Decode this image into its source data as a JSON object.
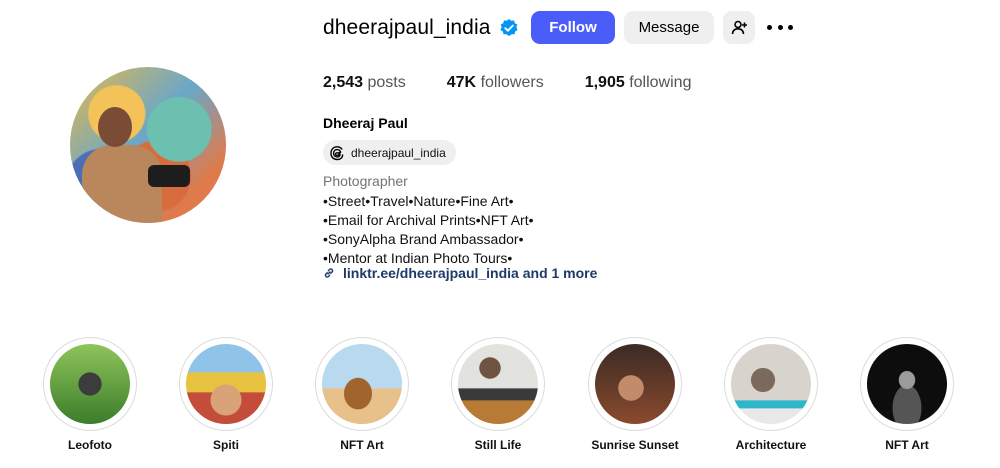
{
  "profile": {
    "username": "dheerajpaul_india",
    "verified": true,
    "buttons": {
      "follow": "Follow",
      "message": "Message"
    },
    "icons": {
      "suggest": "person-add-icon",
      "more": "more-options-icon",
      "verified": "verified-badge-icon"
    }
  },
  "stats": [
    {
      "value": "2,543",
      "label": "posts"
    },
    {
      "value": "47K",
      "label": "followers"
    },
    {
      "value": "1,905",
      "label": "following"
    }
  ],
  "bio": {
    "full_name": "Dheeraj Paul",
    "threads_handle": "dheerajpaul_india",
    "category": "Photographer",
    "lines": [
      "•Street•Travel•Nature•Fine Art•",
      "•Email for Archival Prints•NFT Art•",
      "•SonyAlpha Brand Ambassador•",
      "•Mentor at Indian Photo Tours•"
    ],
    "link": "linktr.ee/dheerajpaul_india and 1 more"
  },
  "highlights": [
    {
      "label": "Leofoto"
    },
    {
      "label": "Spiti"
    },
    {
      "label": "NFT Art"
    },
    {
      "label": "Still Life"
    },
    {
      "label": "Sunrise Sunset"
    },
    {
      "label": "Architecture"
    },
    {
      "label": "NFT Art"
    }
  ],
  "colors": {
    "accent": "#4a5df9",
    "verified": "#0095f6",
    "link": "#1e3a6a",
    "secondary_text": "#737373"
  }
}
